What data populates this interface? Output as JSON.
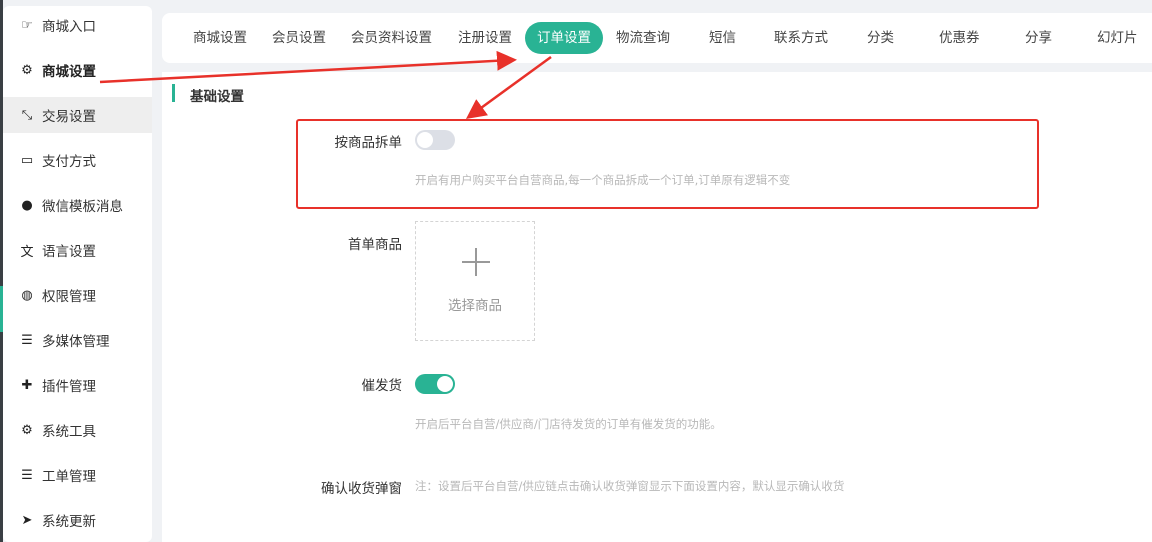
{
  "sidebar": {
    "items": [
      {
        "label": "商城入口",
        "icon": "hand-pointer-icon"
      },
      {
        "label": "商城设置",
        "icon": "gear-icon"
      },
      {
        "label": "交易设置",
        "icon": "arrows-compress-icon"
      },
      {
        "label": "支付方式",
        "icon": "credit-card-icon"
      },
      {
        "label": "微信模板消息",
        "icon": "wechat-icon"
      },
      {
        "label": "语言设置",
        "icon": "language-icon"
      },
      {
        "label": "权限管理",
        "icon": "gamepad-icon"
      },
      {
        "label": "多媒体管理",
        "icon": "list-icon"
      },
      {
        "label": "插件管理",
        "icon": "puzzle-icon"
      },
      {
        "label": "系统工具",
        "icon": "gear-icon"
      },
      {
        "label": "工单管理",
        "icon": "list-icon"
      },
      {
        "label": "系统更新",
        "icon": "paper-plane-icon"
      }
    ]
  },
  "tabs": [
    "商城设置",
    "会员设置",
    "会员资料设置",
    "注册设置",
    "订单设置",
    "物流查询",
    "短信",
    "联系方式",
    "分类",
    "优惠券",
    "分享",
    "幻灯片"
  ],
  "active_tab": "订单设置",
  "section": {
    "title": "基础设置"
  },
  "form": {
    "split_by_product": {
      "label": "按商品拆单",
      "enabled": false,
      "hint": "开启有用户购买平台自营商品,每一个商品拆成一个订单,订单原有逻辑不变"
    },
    "first_order_product": {
      "label": "首单商品",
      "picker_text": "选择商品"
    },
    "urge_shipment": {
      "label": "催发货",
      "enabled": true,
      "hint": "开启后平台自营/供应商/门店待发货的订单有催发货的功能。"
    },
    "confirm_receipt_popup": {
      "label": "确认收货弹窗",
      "hint": "注：设置后平台自营/供应链点击确认收货弹窗显示下面设置内容，默认显示确认收货"
    }
  },
  "colors": {
    "accent": "#29b394",
    "annotation": "#e8312a"
  }
}
